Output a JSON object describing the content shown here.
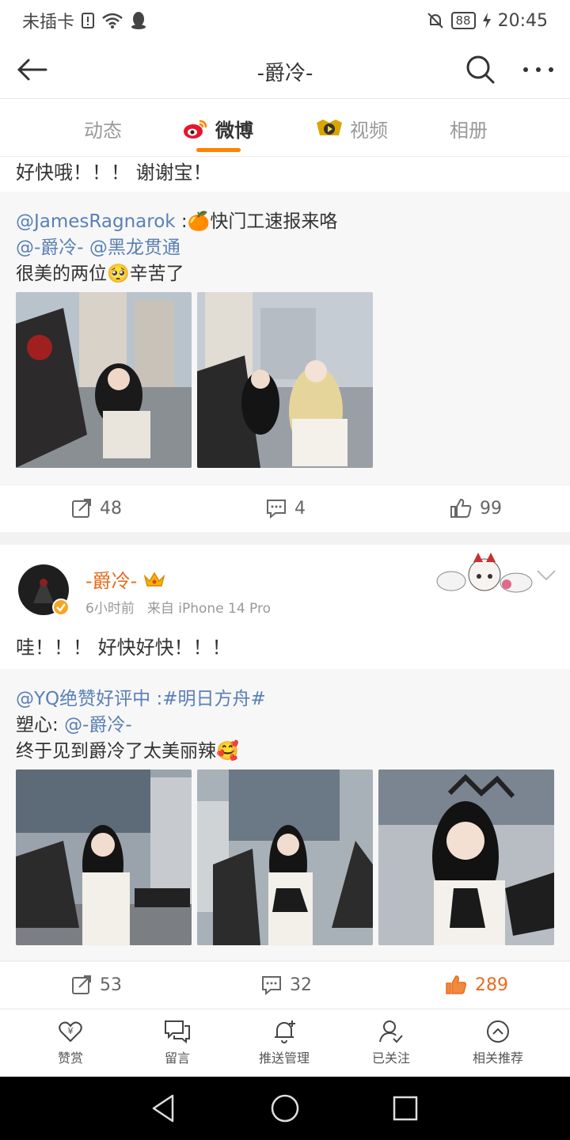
{
  "status": {
    "carrier": "未插卡",
    "battery": "88",
    "time": "20:45"
  },
  "header": {
    "title": "-爵冷-"
  },
  "tabs": [
    {
      "label": "动态"
    },
    {
      "label": "微博"
    },
    {
      "label": "视频"
    },
    {
      "label": "相册"
    }
  ],
  "post1": {
    "text": "好快哦！！！ 谢谢宝！",
    "retweet": {
      "author": "@JamesRagnarok",
      "sep": " :",
      "emoji": "🍊",
      "title_text": "快门工速报来咯",
      "mention1": "@-爵冷-",
      "mention2": "@黑龙贯通",
      "line3a": "很美的两位",
      "emoji2": "🥺",
      "line3b": "辛苦了"
    },
    "repost_count": "48",
    "comment_count": "4",
    "like_count": "99"
  },
  "post2": {
    "author_name": "-爵冷-",
    "meta_time": "6小时前",
    "meta_source": "来自 iPhone 14 Pro",
    "text": "哇！！！ 好快好快！！！",
    "retweet": {
      "author": "@YQ绝赞好评中",
      "sep": " :",
      "hashtag": "#明日方舟#",
      "line2_prefix": "塑心: ",
      "mention": "@-爵冷-",
      "line3": "终于见到爵冷了太美丽辣",
      "emoji": "🥰"
    },
    "repost_count": "53",
    "comment_count": "32",
    "like_count": "289"
  },
  "bottom_nav": [
    {
      "label": "赞赏",
      "icon": "reward-heart-icon"
    },
    {
      "label": "留言",
      "icon": "message-icon"
    },
    {
      "label": "推送管理",
      "icon": "bell-icon"
    },
    {
      "label": "已关注",
      "icon": "followed-user-icon"
    },
    {
      "label": "相关推荐",
      "icon": "chevron-up-circle-icon"
    }
  ],
  "colors": {
    "accent": "#ff8200",
    "link": "#5a80b6",
    "liked": "#e86b1f",
    "name": "#e86b1f"
  }
}
